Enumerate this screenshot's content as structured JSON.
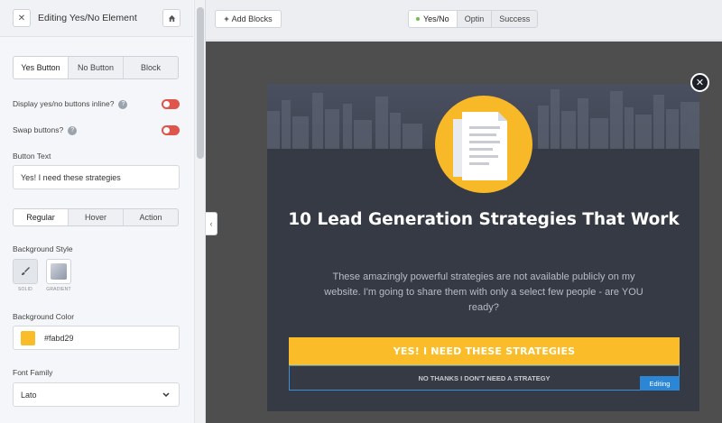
{
  "sidebar": {
    "title": "Editing Yes/No Element",
    "tabs": [
      {
        "label": "Yes Button",
        "active": true
      },
      {
        "label": "No Button",
        "active": false
      },
      {
        "label": "Block",
        "active": false
      }
    ],
    "inline_label": "Display yes/no buttons inline?",
    "swap_label": "Swap buttons?",
    "button_text_label": "Button Text",
    "button_text_value": "Yes! I need these strategies",
    "state_tabs": [
      {
        "label": "Regular",
        "active": true
      },
      {
        "label": "Hover",
        "active": false
      },
      {
        "label": "Action",
        "active": false
      }
    ],
    "bg_style_label": "Background Style",
    "bg_style_options": [
      "SOLID",
      "GRADIENT"
    ],
    "bg_color_label": "Background Color",
    "bg_color_value": "#fabd29",
    "font_family_label": "Font Family",
    "font_family_value": "Lato"
  },
  "topbar": {
    "add_blocks_label": "Add Blocks",
    "views": [
      {
        "label": "Yes/No",
        "active": true
      },
      {
        "label": "Optin",
        "active": false
      },
      {
        "label": "Success",
        "active": false
      }
    ]
  },
  "popup": {
    "headline": "10 Lead Generation Strategies That Work",
    "subtext": "These amazingly powerful strategies are not available publicly on my website. I'm going to share them with only a select few people - are YOU ready?",
    "yes_button": "YES! I NEED THESE STRATEGIES",
    "no_button": "NO THANKS I DON'T NEED A STRATEGY",
    "editing_badge": "Editing"
  },
  "colors": {
    "accent": "#fabd29",
    "toggle_off": "#e0554b",
    "editing_blue": "#2b86d6",
    "popup_bg": "#363a45"
  }
}
